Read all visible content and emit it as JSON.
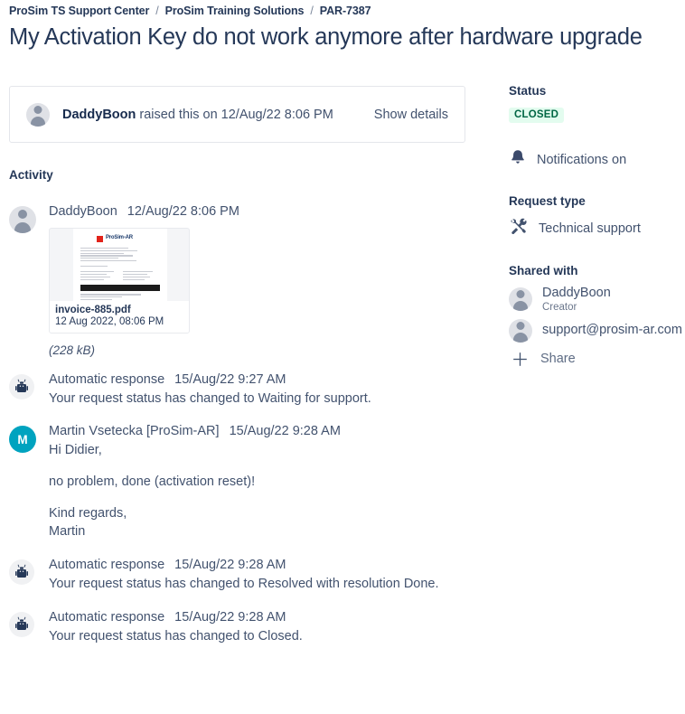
{
  "breadcrumb": {
    "separator": "/",
    "items": [
      {
        "label": "ProSim TS Support Center"
      },
      {
        "label": "ProSim Training Solutions"
      },
      {
        "label": "PAR-7387"
      }
    ]
  },
  "title": "My Activation Key do not work anymore after hardware upgrade",
  "reporter_card": {
    "author": "DaddyBoon",
    "text": " raised this on 12/Aug/22 8:06 PM",
    "show_details_label": "Show details",
    "avatar_icon": "person-avatar-icon"
  },
  "activity": {
    "heading": "Activity",
    "entries": [
      {
        "author": "DaddyBoon",
        "time": "12/Aug/22 8:06 PM",
        "avatar_type": "person",
        "avatar_icon": "person-avatar-icon",
        "attachment": {
          "file_name": "invoice-885.pdf",
          "file_date": "12 Aug 2022, 08:06 PM",
          "file_size": "(228 kB)",
          "thumbnail_logo": "ProSim-AR"
        }
      },
      {
        "author": "Automatic response",
        "time": "15/Aug/22 9:27 AM",
        "avatar_type": "bot",
        "avatar_icon": "robot-avatar-icon",
        "lines": [
          "Your request status has changed to Waiting for support."
        ]
      },
      {
        "author": "Martin Vsetecka [ProSim-AR]",
        "time": "15/Aug/22 9:28 AM",
        "avatar_type": "initial",
        "avatar_initial": "M",
        "avatar_color": "#00a3bf",
        "lines": [
          "Hi Didier,",
          "no problem, done (activation reset)!",
          "Kind regards,",
          "Martin"
        ]
      },
      {
        "author": "Automatic response",
        "time": "15/Aug/22 9:28 AM",
        "avatar_type": "bot",
        "avatar_icon": "robot-avatar-icon",
        "lines": [
          "Your request status has changed to Resolved with resolution Done."
        ]
      },
      {
        "author": "Automatic response",
        "time": "15/Aug/22 9:28 AM",
        "avatar_type": "bot",
        "avatar_icon": "robot-avatar-icon",
        "lines": [
          "Your request status has changed to Closed."
        ]
      }
    ]
  },
  "sidebar": {
    "status_heading": "Status",
    "status_value": "CLOSED",
    "status_bg": "#e3fcef",
    "status_color": "#006644",
    "notifications_label": "Notifications on",
    "notifications_icon": "bell-icon",
    "request_type_heading": "Request type",
    "request_type_value": "Technical support",
    "request_type_icon": "tools-icon",
    "shared_heading": "Shared with",
    "shared_people": [
      {
        "name": "DaddyBoon",
        "role": "Creator",
        "icon": "person-avatar-icon"
      },
      {
        "name": "support@prosim-ar.com",
        "role": "",
        "icon": "person-avatar-icon"
      }
    ],
    "share_label": "Share",
    "share_icon": "plus-icon"
  }
}
